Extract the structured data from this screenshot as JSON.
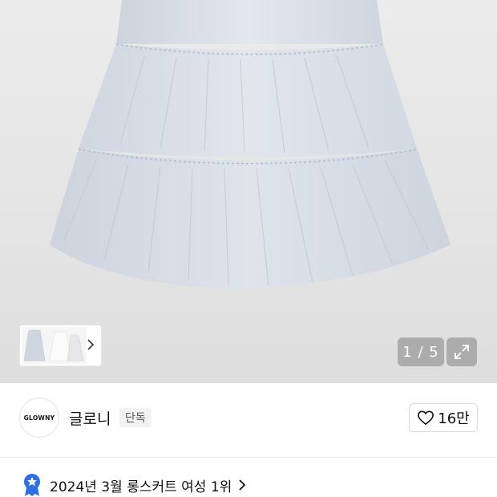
{
  "gallery": {
    "counter": "1 / 5",
    "colors": {
      "background": "#e6e6e6",
      "skirt": "#dce1e9",
      "skirt_shadow": "#c9d0db"
    },
    "thumbnails": [
      {
        "name": "skirt-blue-thumbnail",
        "color": "#cfd6e0"
      },
      {
        "name": "skirt-white-thumbnail",
        "color": "#f4f4f2"
      },
      {
        "name": "skirt-gray-thumbnail",
        "color": "#e8e9ea"
      }
    ],
    "expand_icon": "expand-icon",
    "thumbnail_more_icon": "chevron-right-icon"
  },
  "brand": {
    "logo_text": "GLOWNY",
    "name": "글로니",
    "badge": "단독",
    "like_count": "16만",
    "like_icon": "heart-outline-icon"
  },
  "ranking": {
    "text": "2024년 3월 롱스커트 여성 1위",
    "icon": "ranking-medal-icon",
    "medal_color": "#2f6fe3"
  }
}
